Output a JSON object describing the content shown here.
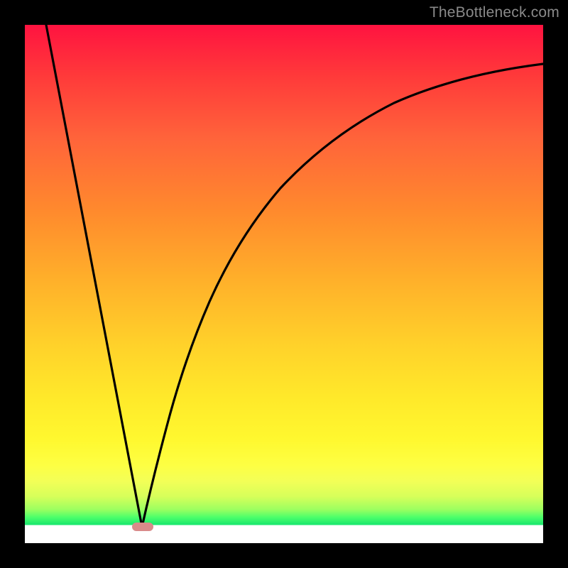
{
  "watermark": "TheBottleneck.com",
  "chart_data": {
    "type": "line",
    "title": "",
    "xlabel": "",
    "ylabel": "",
    "xlim": [
      0,
      100
    ],
    "ylim": [
      0,
      100
    ],
    "grid": false,
    "series": [
      {
        "name": "left-line",
        "x": [
          4,
          22
        ],
        "values": [
          100,
          3
        ]
      },
      {
        "name": "right-curve",
        "x": [
          22,
          24,
          26,
          28,
          31,
          35,
          40,
          46,
          54,
          64,
          76,
          88,
          100
        ],
        "values": [
          3,
          12,
          22,
          31,
          41,
          51,
          60,
          68,
          75,
          81,
          86,
          89.5,
          92
        ]
      }
    ],
    "marker": {
      "name": "minimum-pill",
      "x": 22,
      "y": 3,
      "color": "#d98a8a"
    },
    "background_gradient": {
      "top": "#ff1340",
      "upper_mid": "#ffb22a",
      "lower_mid": "#fdff43",
      "green_band": "#17e66e",
      "bottom": "#ffffff"
    }
  }
}
